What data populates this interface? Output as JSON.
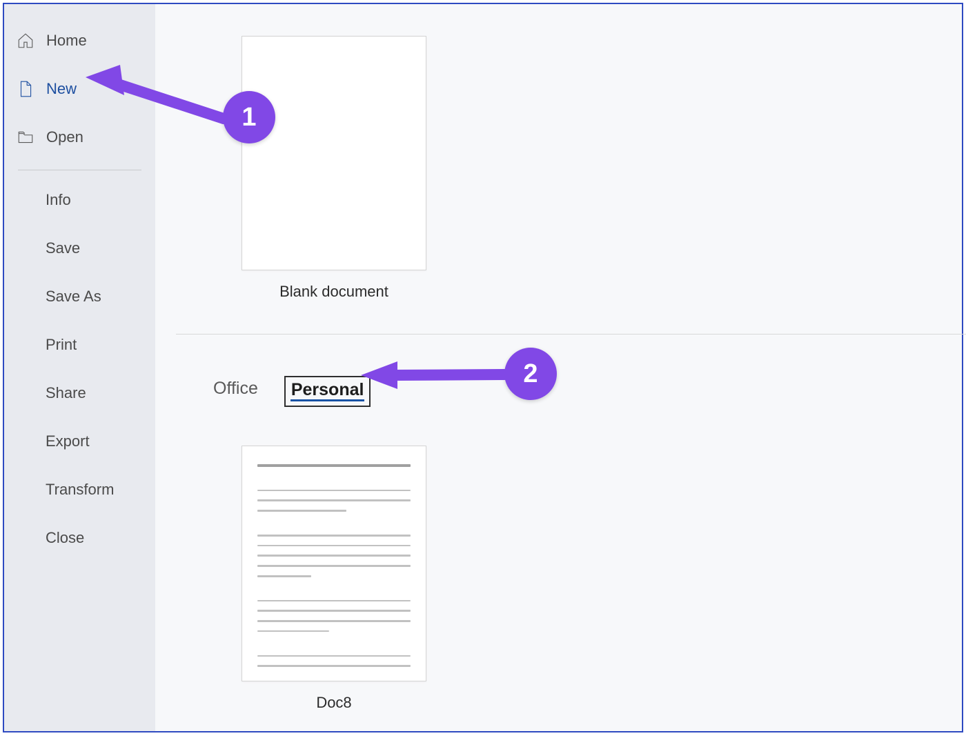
{
  "sidebar": {
    "primary": [
      {
        "label": "Home",
        "icon": "home-icon"
      },
      {
        "label": "New",
        "icon": "document-icon",
        "selected": true
      },
      {
        "label": "Open",
        "icon": "folder-open-icon"
      }
    ],
    "secondary": [
      {
        "label": "Info"
      },
      {
        "label": "Save"
      },
      {
        "label": "Save As"
      },
      {
        "label": "Print"
      },
      {
        "label": "Share"
      },
      {
        "label": "Export"
      },
      {
        "label": "Transform"
      },
      {
        "label": "Close"
      }
    ]
  },
  "main": {
    "blank_template_label": "Blank document",
    "tabs": {
      "office": "Office",
      "personal": "Personal",
      "active": "Personal"
    },
    "personal_template": {
      "label": "Doc8"
    }
  },
  "annotations": {
    "callout1": "1",
    "callout2": "2"
  },
  "colors": {
    "accent": "#1d4fa0",
    "annotation": "#8148e6",
    "frame": "#2e4ac1"
  }
}
